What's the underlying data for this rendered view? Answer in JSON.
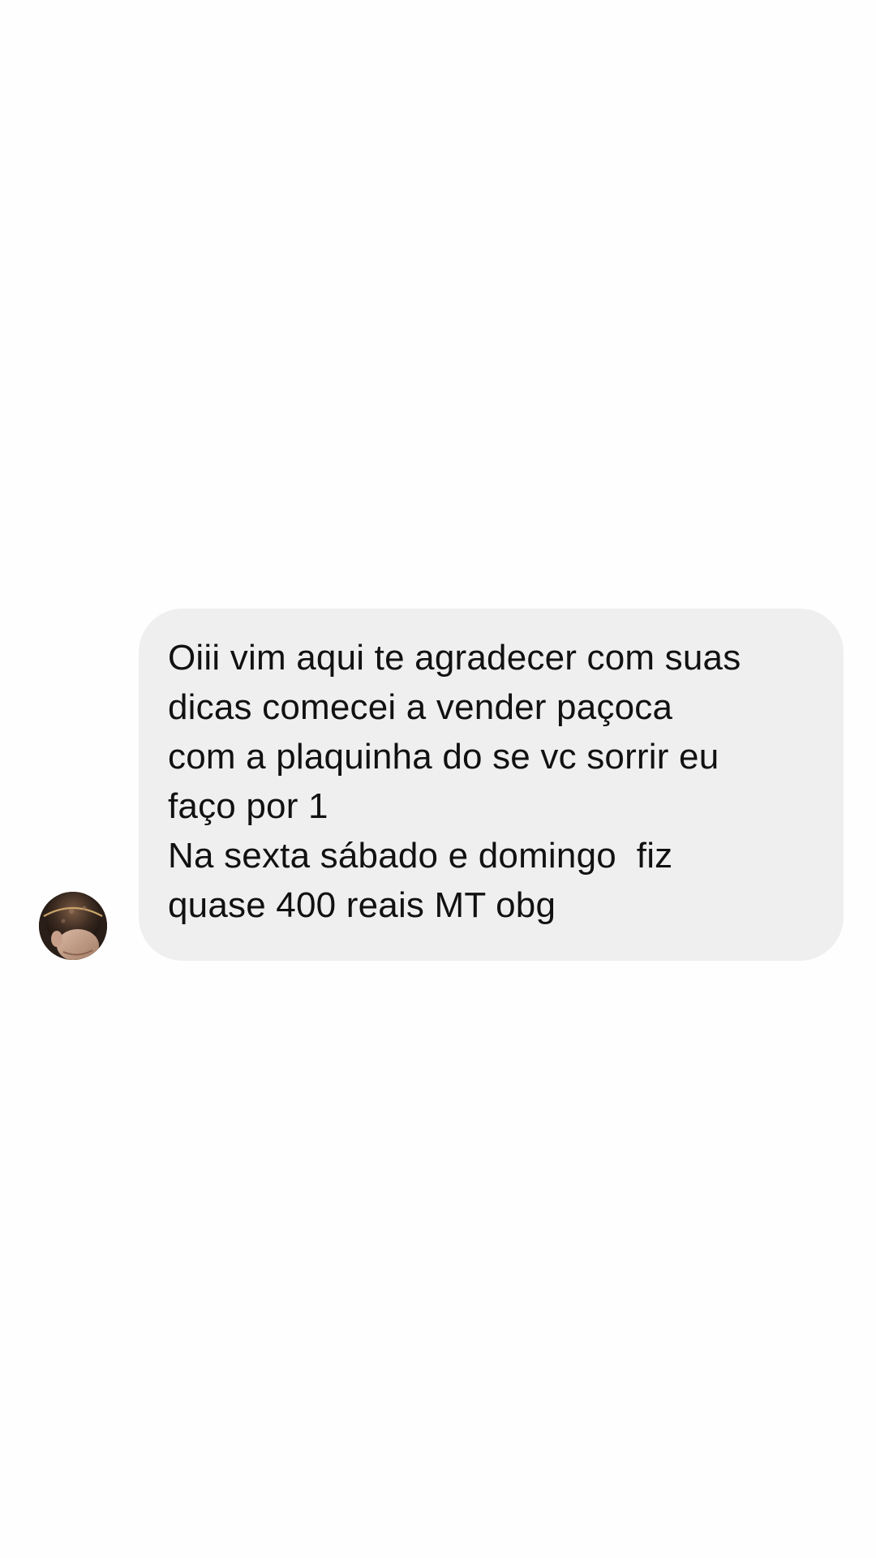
{
  "conversation": {
    "incoming_message": {
      "avatar_icon": "user-avatar-photo",
      "bubble_color": "#efefef",
      "text_color": "#111111",
      "lines": [
        "Oiii vim aqui te agradecer com suas",
        "dicas comecei a vender paçoca",
        "com a plaquinha do se vc sorrir eu",
        "faço por 1",
        "Na sexta sábado e domingo  fiz",
        "quase 400 reais MT obg"
      ]
    }
  },
  "colors": {
    "background": "#fefefe"
  }
}
